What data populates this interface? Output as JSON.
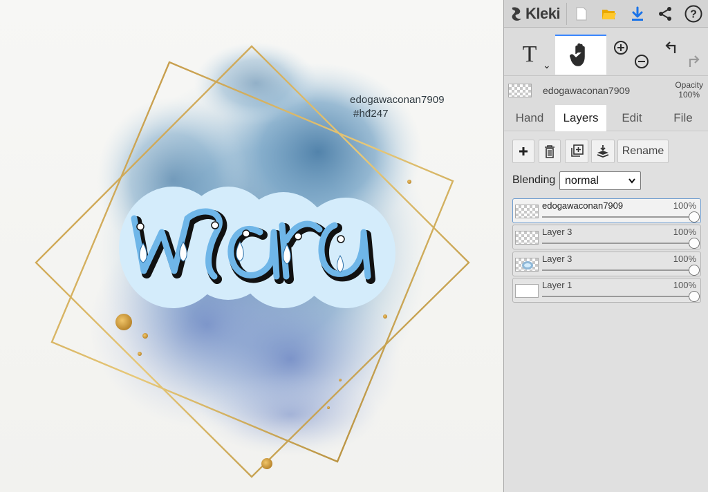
{
  "canvas": {
    "text_lines": [
      "edogawaconan7909",
      "#hđ247"
    ],
    "palette": {
      "gold": "#c9a24a",
      "watercolor_blue": "#6f9ec2",
      "sticker_fill": "#d4ecfb"
    }
  },
  "toolbar": {
    "app_name": "Kleki",
    "buttons": [
      {
        "name": "new-image",
        "icon": "new-page-icon"
      },
      {
        "name": "open-file",
        "icon": "folder-icon",
        "color": "#f0b400"
      },
      {
        "name": "download",
        "icon": "download-icon",
        "color": "#1a73e8"
      },
      {
        "name": "share",
        "icon": "share-icon"
      },
      {
        "name": "help",
        "icon": "help-icon",
        "glyph": "?"
      }
    ]
  },
  "tools": {
    "text_glyph": "T",
    "text_caret": "⌄",
    "active_tool": "hand"
  },
  "current_layer": {
    "name": "edogawaconan7909",
    "opacity_label": "Opacity",
    "opacity_value": "100%"
  },
  "tabs": [
    "Hand",
    "Layers",
    "Edit",
    "File"
  ],
  "active_tab": "Layers",
  "layer_actions": {
    "rename_label": "Rename"
  },
  "blending": {
    "label": "Blending",
    "value": "normal"
  },
  "layers": [
    {
      "name": "edogawaconan7909",
      "opacity": "100%",
      "opacity_fraction": 1.0,
      "active": true,
      "thumb": "checker"
    },
    {
      "name": "Layer 3",
      "opacity": "100%",
      "opacity_fraction": 1.0,
      "active": false,
      "thumb": "checker"
    },
    {
      "name": "Layer 3",
      "opacity": "100%",
      "opacity_fraction": 1.0,
      "active": false,
      "thumb": "checker-art"
    },
    {
      "name": "Layer 1",
      "opacity": "100%",
      "opacity_fraction": 1.0,
      "active": false,
      "thumb": "white"
    }
  ]
}
